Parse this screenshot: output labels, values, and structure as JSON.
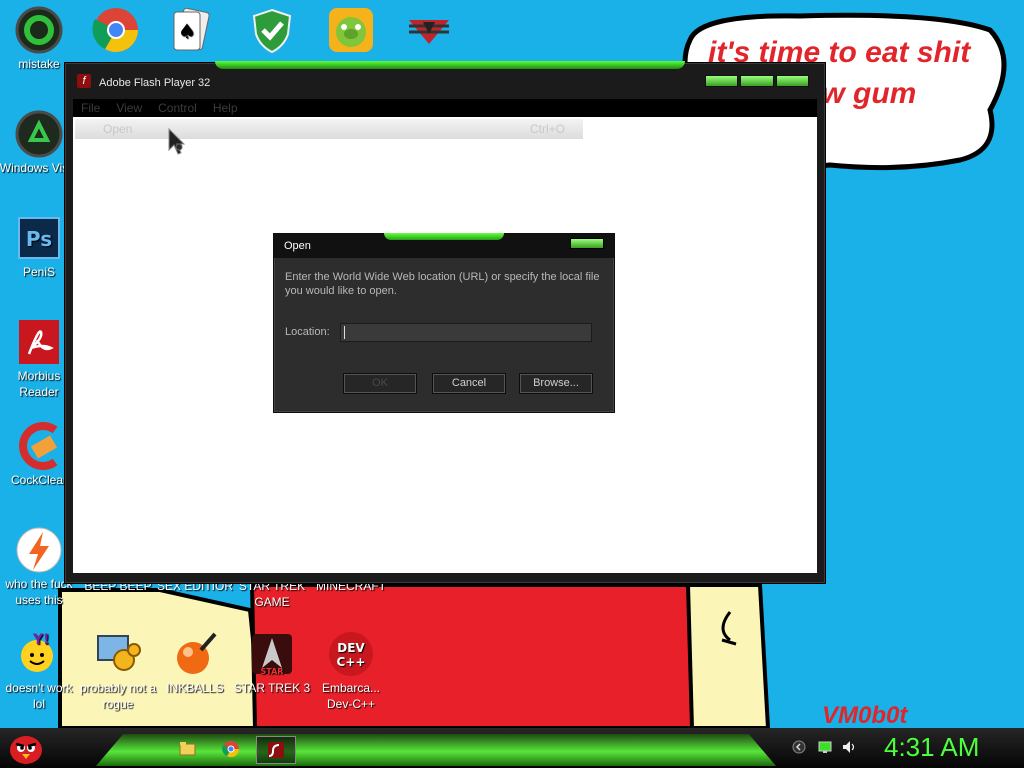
{
  "wallpaper": {
    "speech_text": "it's time to eat shit and chew gum",
    "signature": "VM0b0t"
  },
  "desktop_icons": [
    {
      "label": "mistake",
      "icon": "green-swirl-icon"
    },
    {
      "label": "Windows Vista",
      "icon": "recycle-bin-icon"
    },
    {
      "label": "PeniS",
      "icon": "photoshop-icon"
    },
    {
      "label": "Morbius Reader",
      "icon": "pdf-reader-icon"
    },
    {
      "label": "CockClear",
      "icon": "cleaner-icon"
    },
    {
      "label": "who the fuck uses this",
      "icon": "flash-bolt-icon"
    },
    {
      "label": "doesn't work lol",
      "icon": "yahoo-messenger-icon"
    },
    {
      "label": "probably not a rogue",
      "icon": "gears-monitor-icon"
    },
    {
      "label": "INKBALLS",
      "icon": "inkball-icon"
    },
    {
      "label": "STAR TREK 3",
      "icon": "star-trek-icon"
    },
    {
      "label": "Embarca... Dev-C++",
      "icon": "devcpp-icon"
    },
    {
      "label": "BEEP BEEP",
      "icon": ""
    },
    {
      "label": "SEX EDITIOR",
      "icon": ""
    },
    {
      "label": "STAR TREK GAME",
      "icon": ""
    },
    {
      "label": "MINECRAFT",
      "icon": ""
    }
  ],
  "top_icons": [
    "chrome-icon",
    "solitaire-icon",
    "security-shield-icon",
    "bad-piggies-icon",
    "red-logo-icon"
  ],
  "flash_window": {
    "title": "Adobe Flash Player 32",
    "menu": [
      "File",
      "View",
      "Control",
      "Help"
    ],
    "dropdown": {
      "item": "Open",
      "shortcut": "Ctrl+O"
    }
  },
  "open_dialog": {
    "title": "Open",
    "message": "Enter the World Wide Web location (URL) or specify the local file you would like to open.",
    "location_label": "Location:",
    "location_value": "",
    "ok_label": "OK",
    "cancel_label": "Cancel",
    "browse_label": "Browse..."
  },
  "taskbar": {
    "items": [
      "folder-icon",
      "chrome-icon",
      "flash-player-icon"
    ],
    "tray": [
      "back-arrow-icon",
      "network-icon",
      "volume-icon"
    ],
    "clock": "4:31 AM"
  },
  "colors": {
    "accent_green": "#4cff3c",
    "desktop_blue": "#1ab0e8",
    "speech_red": "#e0252b"
  }
}
